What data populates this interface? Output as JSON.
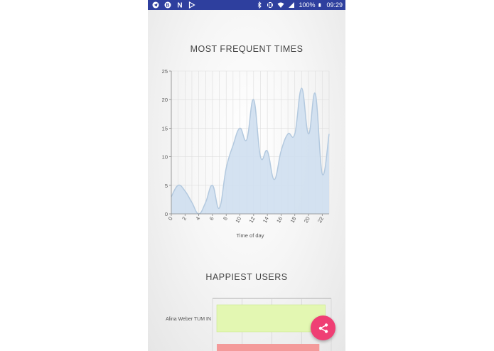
{
  "status_bar": {
    "battery": "100%",
    "time": "09:29",
    "icons_left": [
      "telegram-icon",
      "b-app-icon",
      "n-app-icon",
      "play-store-icon"
    ],
    "icons_right": [
      "bluetooth-icon",
      "vibrate-icon",
      "wifi-icon",
      "signal-icon",
      "battery-icon"
    ]
  },
  "sections": {
    "times_title": "MOST FREQUENT TIMES",
    "users_title": "HAPPIEST USERS"
  },
  "chart_data": [
    {
      "type": "area",
      "title": "MOST FREQUENT TIMES",
      "xlabel": "Time of day",
      "ylabel": "",
      "x": [
        0,
        1,
        2,
        3,
        4,
        5,
        6,
        7,
        8,
        9,
        10,
        11,
        12,
        13,
        14,
        15,
        16,
        17,
        18,
        19,
        20,
        21,
        22,
        23
      ],
      "values": [
        3,
        5,
        4,
        2,
        0,
        2,
        5,
        1,
        8,
        12,
        15,
        13,
        20,
        10,
        11,
        6,
        11,
        14,
        14,
        22,
        14,
        21,
        7,
        14
      ],
      "x_ticks": [
        "0",
        "2",
        "4",
        "6",
        "8",
        "10",
        "12",
        "14",
        "16",
        "18",
        "20",
        "22"
      ],
      "y_ticks": [
        "0",
        "5",
        "10",
        "15",
        "20",
        "25"
      ],
      "xlim": [
        0,
        23
      ],
      "ylim": [
        0,
        25
      ],
      "grid": true,
      "colors": {
        "fill": "#cfdff0",
        "line": "#b3c9df",
        "grid": "#dddddd"
      }
    },
    {
      "type": "bar",
      "orientation": "horizontal",
      "title": "HAPPIEST USERS",
      "categories": [
        "Alina Weber TUM IN"
      ],
      "values": [
        0.95
      ],
      "partial_next_bar_value": 0.9,
      "colors": {
        "bar1": "#e3f7b2",
        "bar1_edge": "#cbe98a",
        "bar2": "#f49a9a",
        "grid": "#cccccc"
      }
    }
  ],
  "fab": {
    "icon": "share-icon",
    "color": "#ef3f74"
  }
}
